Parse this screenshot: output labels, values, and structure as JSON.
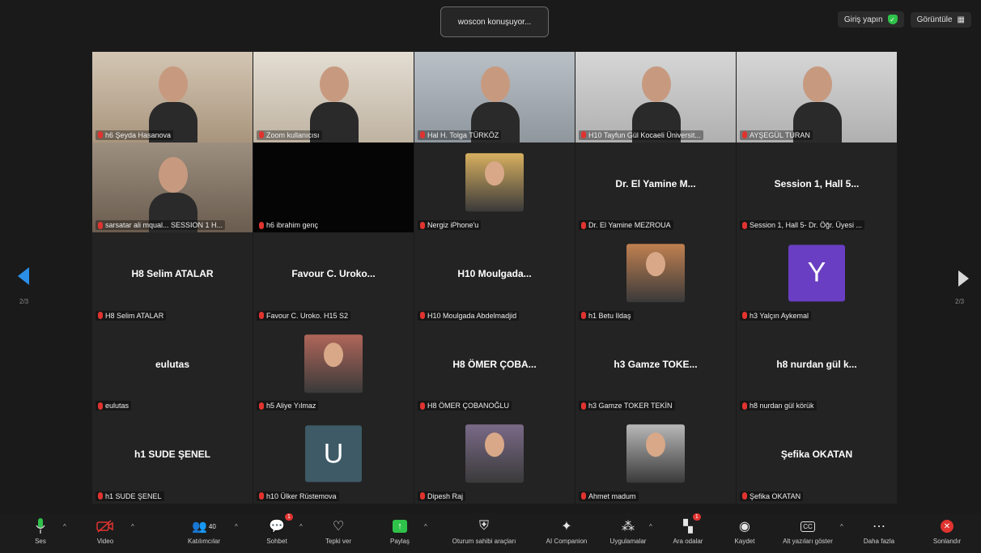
{
  "topbar": {
    "speaking": "woscon konuşuyor...",
    "sign_in": "Giriş yapın",
    "view": "Görüntüle"
  },
  "page_indicator": {
    "left": "2/3",
    "right": "2/3"
  },
  "tiles": [
    {
      "label": "h6 Şeyda Hasanova",
      "big": "",
      "kind": "video",
      "style": "v1"
    },
    {
      "label": "Zoom kullanıcısı",
      "big": "",
      "kind": "video",
      "style": "v2"
    },
    {
      "label": "Hal H. Tolga TÜRKÖZ",
      "big": "",
      "kind": "video",
      "style": "v3"
    },
    {
      "label": "H10 Tayfun Gül Kocaeli Üniversit...",
      "big": "",
      "kind": "video",
      "style": "v4"
    },
    {
      "label": "AYŞEGÜL TURAN",
      "big": "",
      "kind": "video",
      "style": "v4"
    },
    {
      "label": "sarsatar ali mqual... SESSION 1 H...",
      "big": "",
      "kind": "video",
      "style": "v5"
    },
    {
      "label": "h6 ibrahim genç",
      "big": "",
      "kind": "video",
      "style": "v6"
    },
    {
      "label": "Nergiz iPhone'u",
      "big": "",
      "kind": "photo",
      "color": "#d8b060"
    },
    {
      "label": "Dr. El Yamine MEZROUA",
      "big": "Dr. El Yamine M...",
      "kind": "name"
    },
    {
      "label": "Session 1, Hall 5- Dr. Öğr. Üyesi ...",
      "big": "Session 1, Hall 5...",
      "kind": "name"
    },
    {
      "label": "H8 Selim ATALAR",
      "big": "H8 Selim ATALAR",
      "kind": "name"
    },
    {
      "label": "Favour C. Uroko. H15 S2",
      "big": "Favour C. Uroko...",
      "kind": "name"
    },
    {
      "label": "H10 Moulgada Abdelmadjid",
      "big": "H10  Moulgada...",
      "kind": "name"
    },
    {
      "label": "h1 Betu Ildaş",
      "big": "",
      "kind": "photo",
      "color": "#c08050"
    },
    {
      "label": "h3 Yalçın Aykemal",
      "big": "",
      "kind": "letter",
      "letter": "Y",
      "color": "#6a3ec2"
    },
    {
      "label": "eulutas",
      "big": "eulutas",
      "kind": "name"
    },
    {
      "label": "h5 Aliye Yılmaz",
      "big": "",
      "kind": "photo",
      "color": "#b0665a"
    },
    {
      "label": "H8 ÖMER ÇOBANOĞLU",
      "big": "H8 ÖMER ÇOBA...",
      "kind": "name"
    },
    {
      "label": "h3 Gamze TOKER TEKİN",
      "big": "h3 Gamze TOKE...",
      "kind": "name"
    },
    {
      "label": "h8 nurdan gül körük",
      "big": "h8 nurdan gül k...",
      "kind": "name"
    },
    {
      "label": "h1 SUDE ŞENEL",
      "big": "h1 SUDE ŞENEL",
      "kind": "name"
    },
    {
      "label": "h10 Ülker Rüstemova",
      "big": "",
      "kind": "letter",
      "letter": "U",
      "color": "#3d5a66"
    },
    {
      "label": "Dipesh Raj",
      "big": "",
      "kind": "photo",
      "color": "#7a6a88"
    },
    {
      "label": "Ahmet madum",
      "big": "",
      "kind": "photo",
      "color": "#b8b8b8"
    },
    {
      "label": "Şefika OKATAN",
      "big": "Şefika OKATAN",
      "kind": "name"
    }
  ],
  "toolbar": {
    "audio": "Ses",
    "video": "Video",
    "participants": "Katılımcılar",
    "participants_count": "40",
    "chat": "Sohbet",
    "chat_badge": "1",
    "react": "Tepki ver",
    "share": "Paylaş",
    "host_tools": "Oturum sahibi araçları",
    "ai_companion": "AI Companion",
    "apps": "Uygulamalar",
    "breakout": "Ara odalar",
    "breakout_badge": "1",
    "record": "Kaydet",
    "captions": "Alt yazıları göster",
    "more": "Daha fazla",
    "end": "Sonlandır"
  }
}
